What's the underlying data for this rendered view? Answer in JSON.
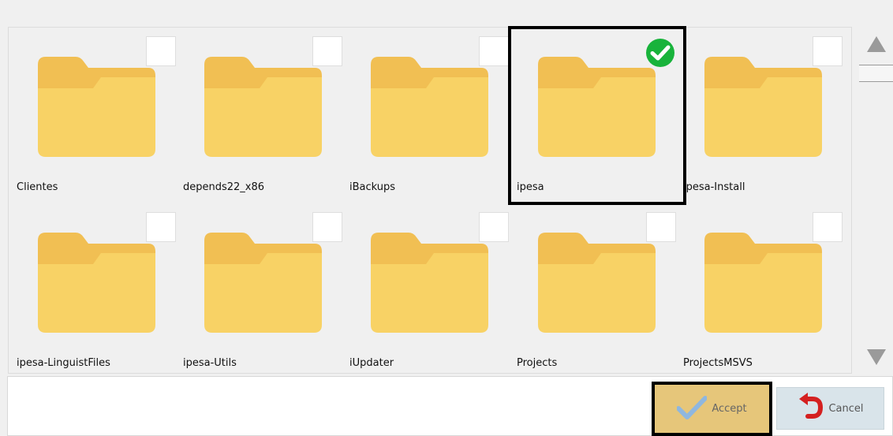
{
  "folders": [
    {
      "name": "Clientes",
      "checked": false
    },
    {
      "name": "depends22_x86",
      "checked": false
    },
    {
      "name": "iBackups",
      "checked": false
    },
    {
      "name": "ipesa",
      "checked": true
    },
    {
      "name": "ipesa-Install",
      "checked": false
    },
    {
      "name": "ipesa-LinguistFiles",
      "checked": false
    },
    {
      "name": "ipesa-Utils",
      "checked": false
    },
    {
      "name": "iUpdater",
      "checked": false
    },
    {
      "name": "Projects",
      "checked": false
    },
    {
      "name": "ProjectsMSVS",
      "checked": false
    }
  ],
  "buttons": {
    "accept_label": "Accept",
    "cancel_label": "Cancel"
  },
  "colors": {
    "folder_front": "#f8d265",
    "folder_back": "#f1bf53",
    "check_green": "#18b33b",
    "accept_bg": "#e6c67a",
    "cancel_bg": "#d9e4ea",
    "cancel_arrow": "#d22"
  }
}
